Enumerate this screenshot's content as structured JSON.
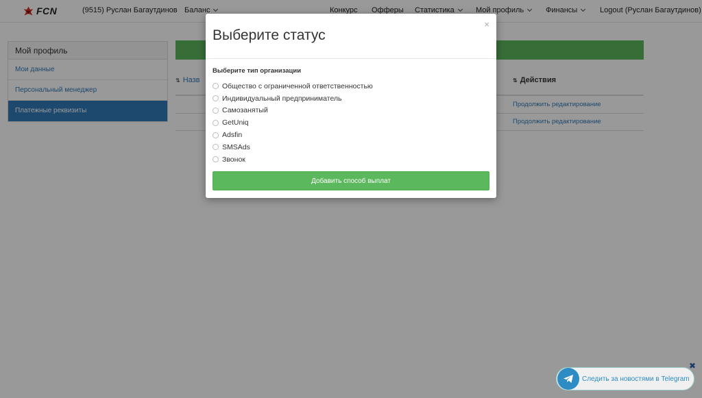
{
  "colors": {
    "accent_green": "#5cb85c",
    "link_blue": "#337ab7",
    "telegram_blue": "#2e8cc4"
  },
  "nav": {
    "logo_text": "FCN",
    "user": "(9515) Руслан Багаутдинов",
    "balance": "Баланс",
    "contest": "Конкурс",
    "offers": "Офферы",
    "stats": "Статистика",
    "profile": "Мой профиль",
    "finance": "Финансы",
    "logout": "Logout (Руслан Багаутдинов)"
  },
  "sidebar": {
    "title": "Мой профиль",
    "items": [
      {
        "label": "Мои данные"
      },
      {
        "label": "Персональный менеджер"
      },
      {
        "label": "Платежные реквизиты",
        "active": true
      }
    ]
  },
  "table": {
    "col_name": "Назв",
    "col_actions": "Действия",
    "rows": [
      {
        "action": "Продолжить редактирование"
      },
      {
        "action": "Продолжить редактирование"
      }
    ]
  },
  "modal": {
    "title": "Выберите статус",
    "close": "×",
    "field_label": "Выберите тип организации",
    "options": [
      "Общество с ограниченной ответственностью",
      "Индивидуальный предприниматель",
      "Самозанятый",
      "GetUniq",
      "Adsfin",
      "SMSAds",
      "Звонок"
    ],
    "submit": "Добавить способ выплат"
  },
  "telegram": {
    "label": "Следить за новостями в Telegram",
    "close": "✖"
  }
}
